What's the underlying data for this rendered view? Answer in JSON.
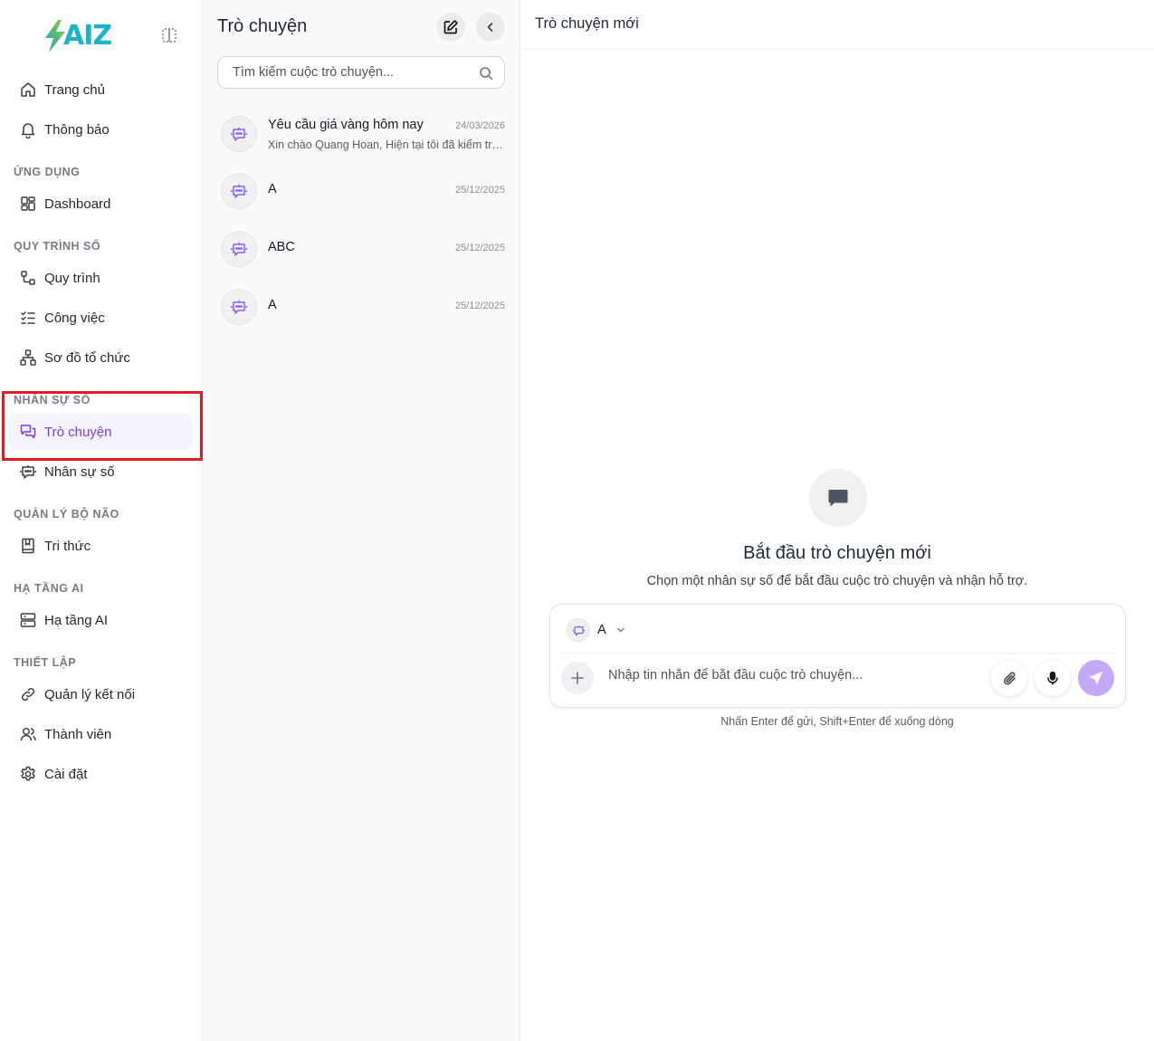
{
  "app": {
    "logo_text": "AIZ"
  },
  "sidebar": {
    "items": [
      {
        "label": "Trang chủ",
        "icon": "home-icon"
      },
      {
        "label": "Thông báo",
        "icon": "bell-icon"
      },
      {
        "label": "Dashboard",
        "icon": "dashboard-icon"
      },
      {
        "label": "Quy trình",
        "icon": "workflow-icon"
      },
      {
        "label": "Công việc",
        "icon": "task-list-icon"
      },
      {
        "label": "Sơ đồ tổ chức",
        "icon": "org-chart-icon"
      },
      {
        "label": "Trò chuyện",
        "icon": "chat-icon",
        "active": true
      },
      {
        "label": "Nhân sự số",
        "icon": "bot-icon"
      },
      {
        "label": "Tri thức",
        "icon": "book-icon"
      },
      {
        "label": "Hạ tầng AI",
        "icon": "server-icon"
      },
      {
        "label": "Quản lý kết nối",
        "icon": "link-icon"
      },
      {
        "label": "Thành viên",
        "icon": "users-icon"
      },
      {
        "label": "Cài đặt",
        "icon": "settings-icon"
      }
    ],
    "sections": [
      "ỨNG DỤNG",
      "QUY TRÌNH SỐ",
      "NHÂN SỰ SỐ",
      "QUẢN LÝ BỘ NÃO",
      "HẠ TẦNG AI",
      "THIẾT LẬP"
    ]
  },
  "conversations": {
    "title": "Trò chuyện",
    "search_placeholder": "Tìm kiếm cuộc trò chuyện...",
    "items": [
      {
        "name": "Yêu cầu giá vàng hôm nay",
        "date": "24/03/2026",
        "preview": "Xin chào Quang Hoan, Hiện tại tôi đã kiểm tra giá vàng hôm nay"
      },
      {
        "name": "A",
        "date": "25/12/2025",
        "preview": ""
      },
      {
        "name": "ABC",
        "date": "25/12/2025",
        "preview": ""
      },
      {
        "name": "A",
        "date": "25/12/2025",
        "preview": ""
      }
    ]
  },
  "main": {
    "title": "Trò chuyện mới",
    "empty_title": "Bắt đầu trò chuyện mới",
    "empty_subtitle": "Chọn một nhân sự số để bắt đầu cuộc trò chuyện và nhận hỗ trợ.",
    "selected_agent": "A",
    "input_placeholder": "Nhập tin nhắn để bắt đầu cuộc trò chuyện...",
    "hint": "Nhấn Enter để gửi, Shift+Enter để xuống dòng"
  },
  "colors": {
    "accent": "#7c3aed",
    "send_button": "#c4a9f7",
    "highlight": "#e01e26"
  }
}
